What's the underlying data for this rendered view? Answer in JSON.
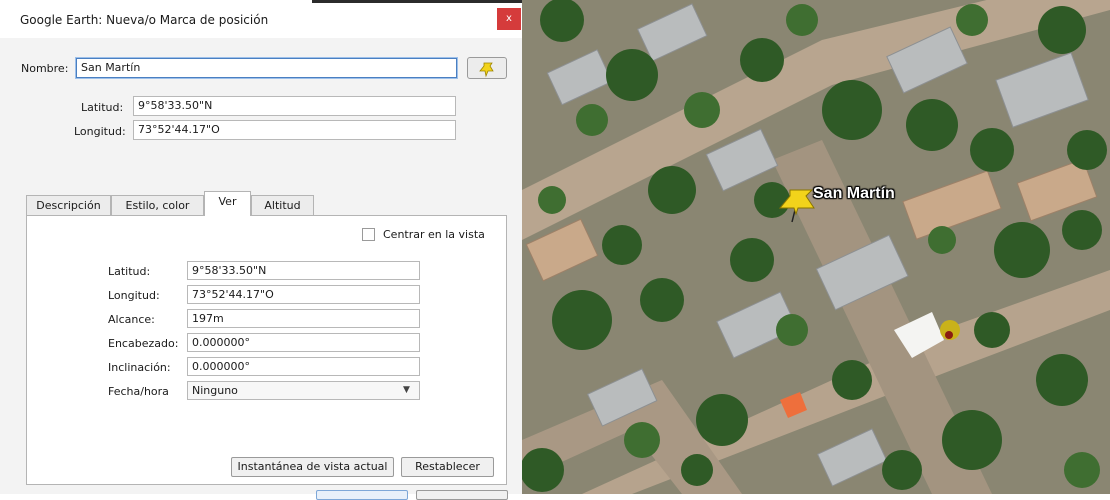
{
  "window": {
    "title": "Google Earth: Nueva/o Marca de posición",
    "close_glyph": "x"
  },
  "header": {
    "name_label": "Nombre:",
    "name_value": "San Martín",
    "lat_label": "Latitud:",
    "lat_value": "9°58'33.50\"N",
    "lon_label": "Longitud:",
    "lon_value": "73°52'44.17\"O",
    "pin_icon": "yellow-pushpin-icon"
  },
  "tabs": [
    {
      "label": "Descripción"
    },
    {
      "label": "Estilo, color"
    },
    {
      "label": "Ver"
    },
    {
      "label": "Altitud"
    }
  ],
  "active_tab": "Ver",
  "view": {
    "center_label": "Centrar en la vista",
    "center_checked": false,
    "lat_label": "Latitud:",
    "lat_value": "9°58'33.50\"N",
    "lon_label": "Longitud:",
    "lon_value": "73°52'44.17\"O",
    "range_label": "Alcance:",
    "range_value": "197m",
    "heading_label": "Encabezado:",
    "heading_value": "0.000000°",
    "tilt_label": "Inclinación:",
    "tilt_value": "0.000000°",
    "datetime_label": "Fecha/hora",
    "datetime_value": "Ninguno",
    "snapshot_button": "Instantánea de vista actual",
    "reset_button": "Restablecer"
  },
  "map": {
    "placemark_label": "San Martín",
    "placemark_icon": "yellow-pushpin-icon"
  },
  "colors": {
    "accent": "#4a7fc1",
    "close": "#d53b3b",
    "pin": "#f2d31b"
  }
}
